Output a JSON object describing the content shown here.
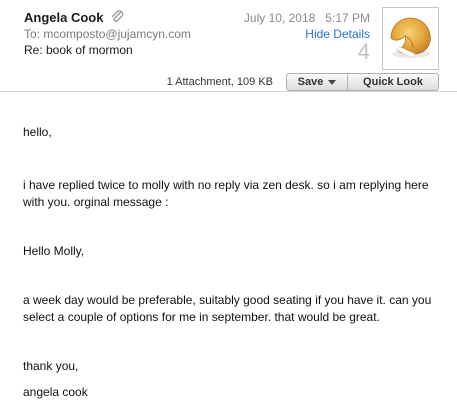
{
  "header": {
    "sender": "Angela Cook",
    "to_label": "To:",
    "to_value": "mcomposto@jujamcyn.com",
    "subject": "Re: book of mormon",
    "date": "July 10, 2018   5:17 PM",
    "hide_details": "Hide Details",
    "message_count": "4"
  },
  "attachments": {
    "info": "1 Attachment, 109 KB",
    "save_label": "Save",
    "quick_look_label": "Quick Look"
  },
  "body": {
    "greeting": "hello,",
    "paragraph1": "i have replied twice to molly with no reply via zen desk. so i am replying here with you.  orginal message :",
    "quoted_greeting": "Hello Molly,",
    "paragraph2": "a week day would be preferable, suitably good seating if you have it. can you select a couple of options for me in september. that would be great.",
    "closing": "thank you,",
    "signature": "angela cook"
  },
  "icons": {
    "attachment": "paperclip-icon",
    "avatar": "fortune-cookie-avatar",
    "dropdown": "chevron-down-icon"
  },
  "colors": {
    "link": "#2a6fd6",
    "muted": "#8a8a8a"
  }
}
